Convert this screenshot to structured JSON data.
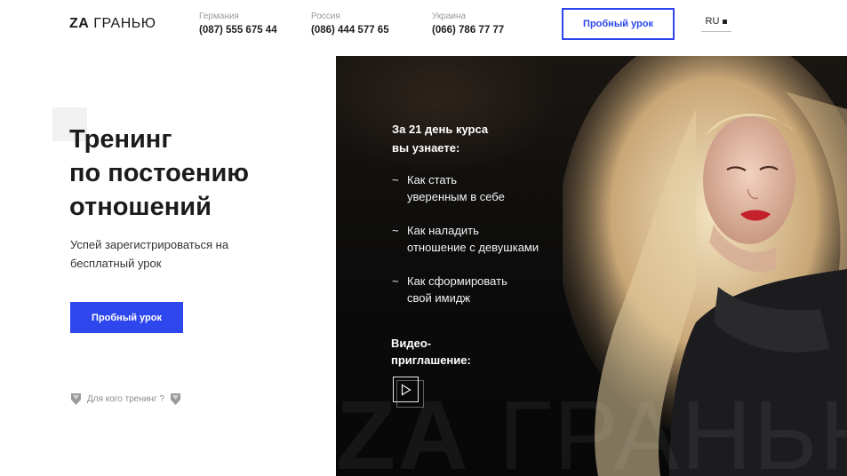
{
  "header": {
    "logo_bold": "ZA",
    "logo_light": "ГРАНЬЮ",
    "phones": [
      {
        "country": "Германия",
        "number": "(087) 555 675 44"
      },
      {
        "country": "Россия",
        "number": "(086) 444 577 65"
      },
      {
        "country": "Украина",
        "number": "(066) 786 77 77"
      }
    ],
    "cta_label": "Пробный урок",
    "language": "RU"
  },
  "hero": {
    "title_lines": [
      "Тренинг",
      "по постоению",
      "отношений"
    ],
    "subtitle_lines": [
      "Успей зарегистрироваться на",
      "бесплатный урок"
    ],
    "cta_label": "Пробный урок",
    "who_link": "Для кого тренинг ?"
  },
  "course": {
    "intro_lines": [
      "За 21 день курса",
      "вы узнаете:"
    ],
    "items": [
      {
        "lines": [
          "Как стать",
          "уверенным в себе"
        ]
      },
      {
        "lines": [
          "Как наладить",
          "отношение с девушками"
        ]
      },
      {
        "lines": [
          "Как сформировать",
          "свой имидж"
        ]
      }
    ],
    "bullet": "~",
    "video_lines": [
      "Видео-",
      "приглашение:"
    ],
    "watermark_bold": "ZA",
    "watermark_light": "ГРАНЬЮ"
  },
  "colors": {
    "accent": "#2d46ee",
    "panel": "#0b0b0b",
    "text": "#1b1b1b"
  },
  "icons": {
    "play": "play-icon",
    "gem": "diamond-icon"
  }
}
